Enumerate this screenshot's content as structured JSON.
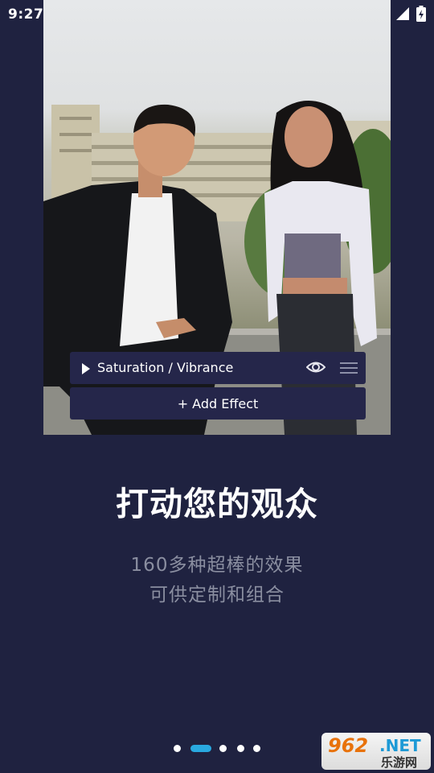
{
  "status_bar": {
    "time": "9:27",
    "icons": [
      "wifi-icon",
      "signal-icon",
      "battery-charging-icon"
    ]
  },
  "effect_panel": {
    "effect_name": "Saturation / Vibrance",
    "add_effect_label": "+ Add Effect",
    "icons": [
      "play-icon",
      "eye-icon",
      "drag-handle-icon"
    ]
  },
  "headline": "打动您的观众",
  "subtitle": {
    "line1": "160多种超棒的效果",
    "line2": "可供定制和组合"
  },
  "pager": {
    "count": 5,
    "active_index": 1,
    "active_color": "#29a9e0"
  },
  "watermark": {
    "top": "962",
    "net": ".NET",
    "bottom": "乐游网"
  },
  "colors": {
    "background": "#1f2240",
    "panel": "#25264a",
    "accent": "#29a9e0",
    "subtitle": "#8a8ea0"
  }
}
